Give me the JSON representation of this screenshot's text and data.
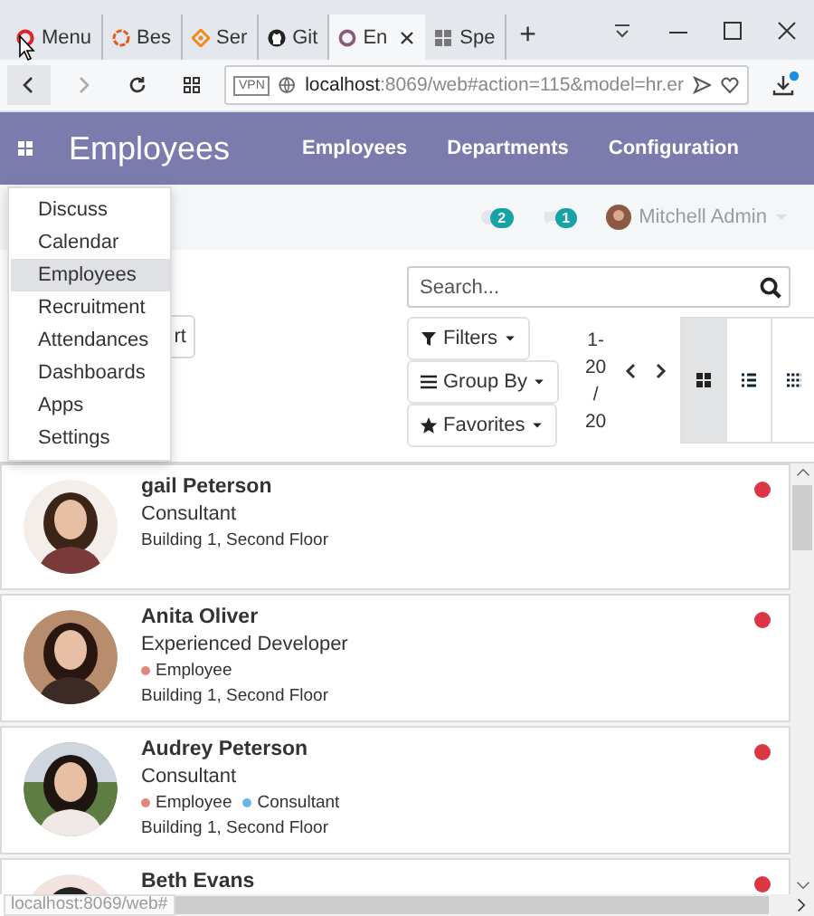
{
  "browser": {
    "tabs": [
      {
        "label": "Menu",
        "selected": false
      },
      {
        "label": "Bes",
        "selected": false
      },
      {
        "label": "Ser",
        "selected": false
      },
      {
        "label": "Git",
        "selected": false
      },
      {
        "label": "En",
        "selected": true
      },
      {
        "label": "Spe",
        "selected": false
      }
    ],
    "new_tab": "+",
    "address": {
      "vpn": "VPN",
      "host": "localhost",
      "path": ":8069/web#action=115&model=hr.er"
    }
  },
  "navbar": {
    "brand": "Employees",
    "menu": [
      "Employees",
      "Departments",
      "Configuration"
    ]
  },
  "systray": {
    "activity_count": "2",
    "message_count": "1",
    "user": "Mitchell Admin"
  },
  "apps_menu": [
    {
      "label": "Discuss",
      "selected": false
    },
    {
      "label": "Calendar",
      "selected": false
    },
    {
      "label": "Employees",
      "selected": true
    },
    {
      "label": "Recruitment",
      "selected": false
    },
    {
      "label": "Attendances",
      "selected": false
    },
    {
      "label": "Dashboards",
      "selected": false
    },
    {
      "label": "Apps",
      "selected": false
    },
    {
      "label": "Settings",
      "selected": false
    }
  ],
  "control_panel": {
    "button_fragment": "rt",
    "search": {
      "placeholder": "Search..."
    },
    "filters": [
      "Filters",
      "Group By",
      "Favorites"
    ],
    "pager": "1-20 / 20",
    "views": [
      {
        "kind": "kanban",
        "selected": true
      },
      {
        "kind": "list",
        "selected": false
      },
      {
        "kind": "grid",
        "selected": false
      }
    ]
  },
  "employees": [
    {
      "name": "gail Peterson",
      "job": "Consultant",
      "location": "Building 1, Second Floor"
    },
    {
      "name": "Anita Oliver",
      "job": "Experienced Developer",
      "tags": [
        {
          "label": "Employee",
          "color": "#e0897a"
        }
      ],
      "location": "Building 1, Second Floor"
    },
    {
      "name": "Audrey Peterson",
      "job": "Consultant",
      "tags": [
        {
          "label": "Employee",
          "color": "#e0897a"
        },
        {
          "label": "Consultant",
          "color": "#6cb6e6"
        }
      ],
      "location": "Building 1, Second Floor"
    },
    {
      "name": "Beth Evans"
    }
  ],
  "status_url": "localhost:8069/web#"
}
